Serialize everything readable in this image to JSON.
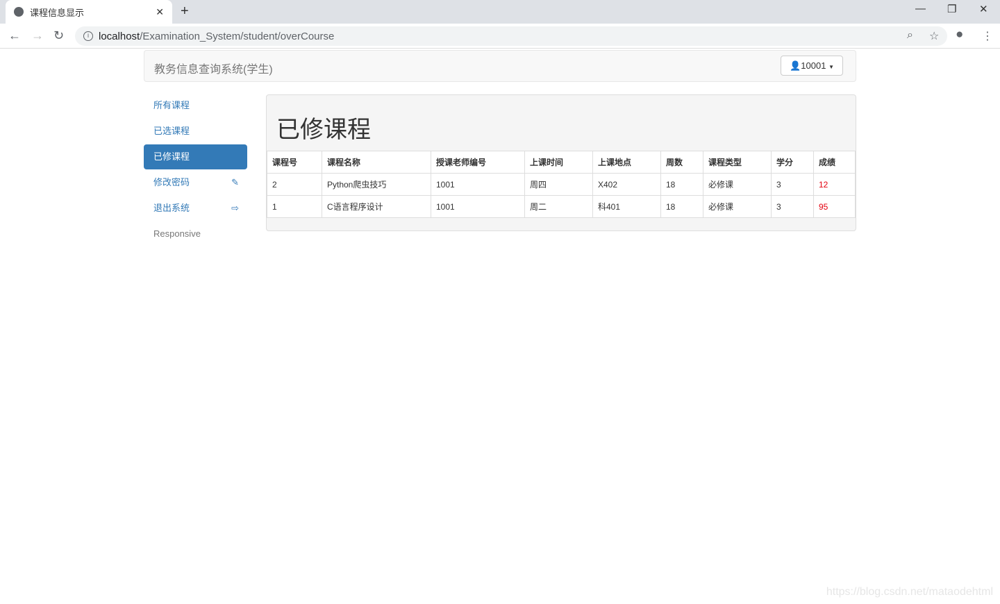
{
  "browser": {
    "tab_title": "课程信息显示",
    "url_host": "localhost",
    "url_path": "/Examination_System/student/overCourse"
  },
  "navbar": {
    "brand": "教务信息查询系统(学生)",
    "user": "10001"
  },
  "sidebar": {
    "items": [
      {
        "label": "所有课程"
      },
      {
        "label": "已选课程"
      },
      {
        "label": "已修课程"
      },
      {
        "label": "修改密码"
      },
      {
        "label": "退出系统"
      },
      {
        "label": "Responsive"
      }
    ]
  },
  "main": {
    "title": "已修课程",
    "headers": [
      "课程号",
      "课程名称",
      "授课老师编号",
      "上课时间",
      "上课地点",
      "周数",
      "课程类型",
      "学分",
      "成绩"
    ],
    "rows": [
      [
        "2",
        "Python爬虫技巧",
        "1001",
        "周四",
        "X402",
        "18",
        "必修课",
        "3",
        "12"
      ],
      [
        "1",
        "C语言程序设计",
        "1001",
        "周二",
        "科401",
        "18",
        "必修课",
        "3",
        "95"
      ]
    ]
  },
  "watermark": "https://blog.csdn.net/mataodehtml"
}
